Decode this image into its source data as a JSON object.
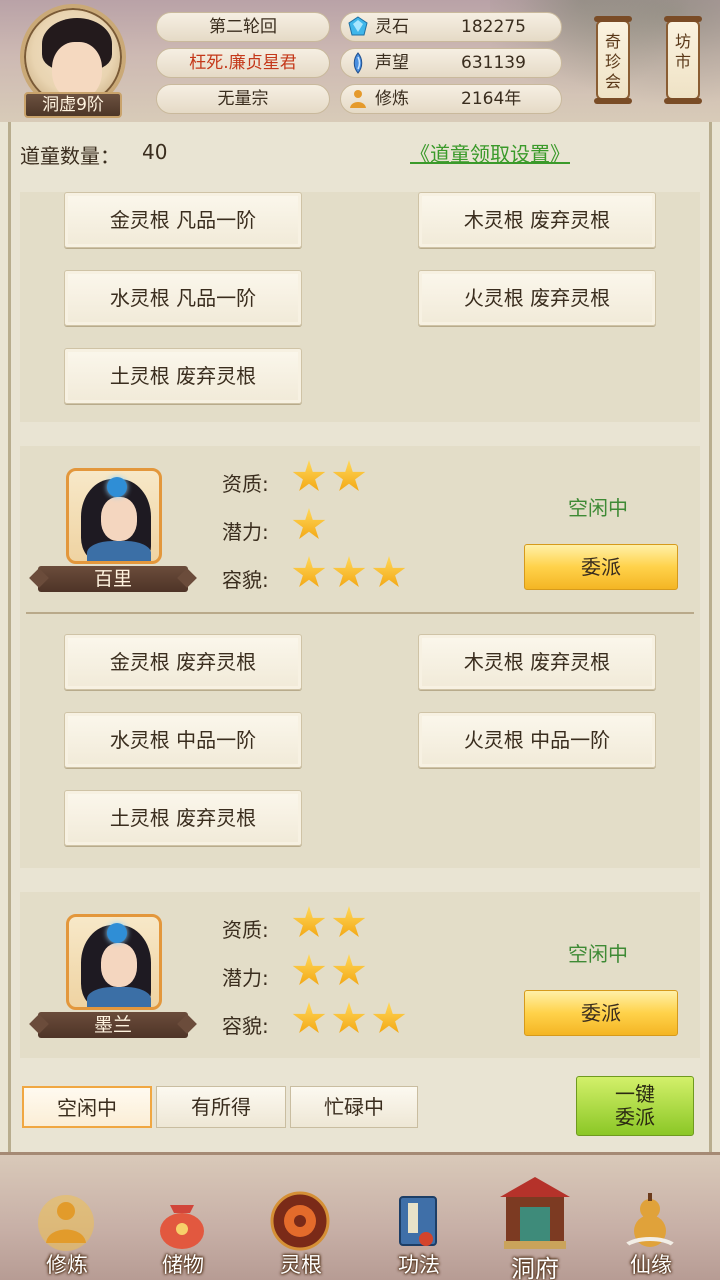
{
  "header": {
    "rank": "洞虚9阶",
    "plates": [
      "第二轮回",
      "枉死.廉贞星君",
      "无量宗"
    ],
    "resources": [
      {
        "label": "灵石",
        "value": "182275",
        "icon": "spirit-stone-icon",
        "color": "#3fb6ea"
      },
      {
        "label": "声望",
        "value": "631139",
        "icon": "reputation-icon",
        "color": "#4a8fe0"
      },
      {
        "label": "修炼",
        "value": "2164年",
        "icon": "cultivation-icon",
        "color": "#e59a2c"
      }
    ],
    "side_buttons": [
      "奇珍会",
      "坊市"
    ]
  },
  "main": {
    "count_label": "道童数量：",
    "count_value": "40",
    "settings_link": "《道童领取设置》",
    "first_roots": [
      "金灵根 凡品一阶",
      "木灵根 废弃灵根",
      "水灵根 凡品一阶",
      "火灵根 废弃灵根",
      "土灵根 废弃灵根"
    ],
    "attr_labels": [
      "资质:",
      "潜力:",
      "容貌:"
    ],
    "disciples": [
      {
        "name": "百里",
        "aptitude": 2,
        "potential": 1,
        "appearance": 3,
        "status": "空闲中",
        "assign": "委派",
        "roots": [
          "金灵根 废弃灵根",
          "木灵根 废弃灵根",
          "水灵根 中品一阶",
          "火灵根 中品一阶",
          "土灵根 废弃灵根"
        ]
      },
      {
        "name": "墨兰",
        "aptitude": 2,
        "potential": 2,
        "appearance": 3,
        "status": "空闲中",
        "assign": "委派"
      }
    ],
    "tabs": [
      "空闲中",
      "有所得",
      "忙碌中"
    ],
    "active_tab": "空闲中",
    "onekey": [
      "一键",
      "委派"
    ]
  },
  "bottom_nav": [
    {
      "label": "修炼",
      "icon": "meditation-icon"
    },
    {
      "label": "储物",
      "icon": "storage-bag-icon"
    },
    {
      "label": "灵根",
      "icon": "spirit-root-icon"
    },
    {
      "label": "功法",
      "icon": "book-icon"
    },
    {
      "label": "洞府",
      "icon": "cave-mansion-icon"
    },
    {
      "label": "仙缘",
      "icon": "gourd-icon"
    }
  ]
}
